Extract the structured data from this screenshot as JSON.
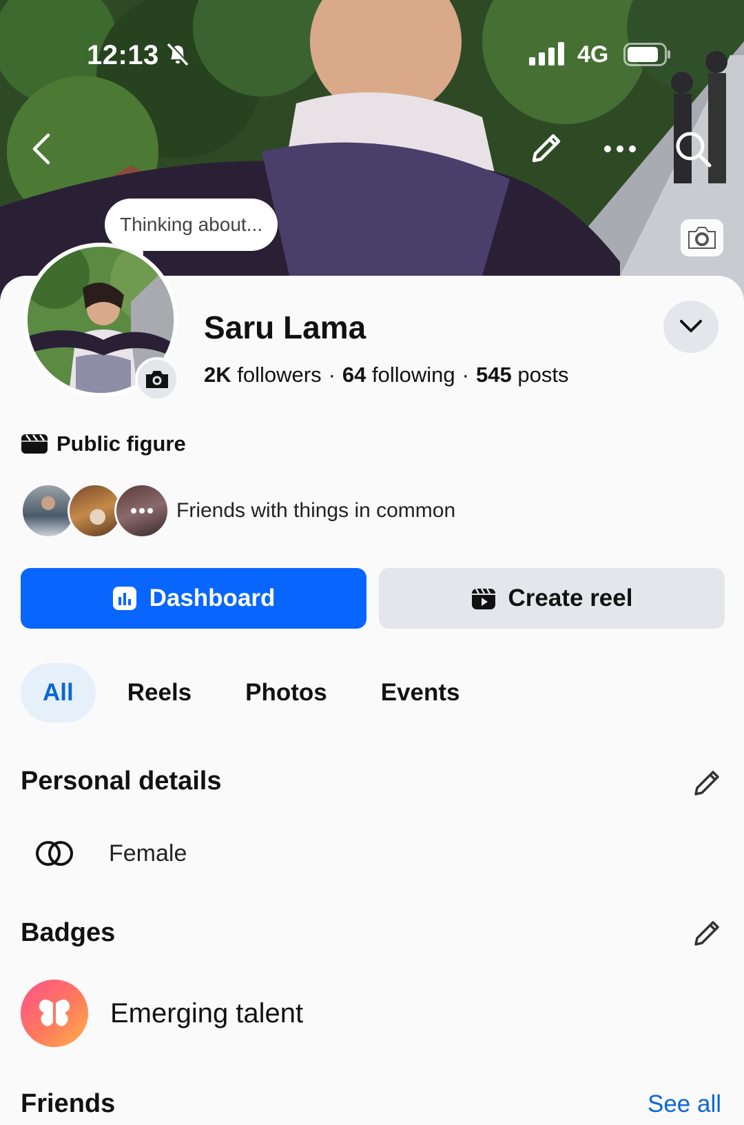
{
  "status_bar": {
    "time": "12:13",
    "network": "4G"
  },
  "cover": {
    "thought_bubble": "Thinking about..."
  },
  "profile": {
    "name": "Saru Lama",
    "followers_count": "2K",
    "followers_label": "followers",
    "following_count": "64",
    "following_label": "following",
    "posts_count": "545",
    "posts_label": "posts",
    "separator": "·",
    "category": "Public figure",
    "mutual_text": "Friends with things in common"
  },
  "actions": {
    "primary_label": "Dashboard",
    "secondary_label": "Create reel"
  },
  "tabs": [
    {
      "label": "All",
      "active": true
    },
    {
      "label": "Reels",
      "active": false
    },
    {
      "label": "Photos",
      "active": false
    },
    {
      "label": "Events",
      "active": false
    }
  ],
  "personal_details": {
    "title": "Personal details",
    "items": [
      {
        "icon": "gender-rings-icon",
        "label": "Female"
      }
    ]
  },
  "badges": {
    "title": "Badges",
    "items": [
      {
        "icon": "butterfly-icon",
        "label": "Emerging talent"
      }
    ]
  },
  "friends": {
    "title": "Friends",
    "see_all": "See all"
  },
  "colors": {
    "accent": "#0866ff",
    "link": "#0a66d6",
    "active_tab_bg": "#e6f0fb",
    "secondary_button": "#e4e6eb"
  }
}
